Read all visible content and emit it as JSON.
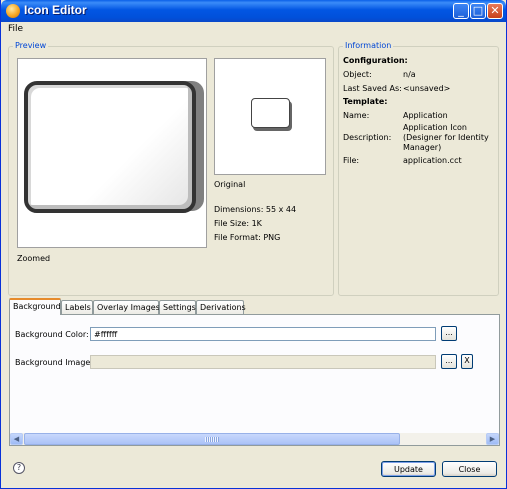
{
  "window": {
    "title": "Icon Editor"
  },
  "menu": {
    "file": "File"
  },
  "preview": {
    "legend": "Preview",
    "zoomed_label": "Zoomed",
    "original_label": "Original",
    "dimensions": "Dimensions: 55 x 44",
    "file_size": "File Size: 1K",
    "file_format": "File Format: PNG"
  },
  "information": {
    "legend": "Information",
    "configuration_heading": "Configuration:",
    "object_label": "Object:",
    "object_value": "n/a",
    "last_saved_label": "Last Saved As:",
    "last_saved_value": "<unsaved>",
    "template_heading": "Template:",
    "name_label": "Name:",
    "name_value": "Application",
    "description_label": "Description:",
    "description_value": "Application Icon (Designer for Identity Manager)",
    "file_label": "File:",
    "file_value": "application.cct"
  },
  "tabs": [
    "Background",
    "Labels",
    "Overlay Images",
    "Settings",
    "Derivations"
  ],
  "background_tab": {
    "color_label": "Background Color:",
    "color_value": "#ffffff",
    "image_label": "Background Image:",
    "image_value": "",
    "browse_label": "...",
    "clear_label": "X"
  },
  "buttons": {
    "update": "Update",
    "close": "Close",
    "help": "?"
  },
  "titlebar": {
    "minimize": "_",
    "maximize": "□",
    "close": "✕"
  },
  "colors": {
    "title_blue": "#0054e3",
    "legend_blue": "#0046d5",
    "tab_highlight": "#e68b2c"
  }
}
